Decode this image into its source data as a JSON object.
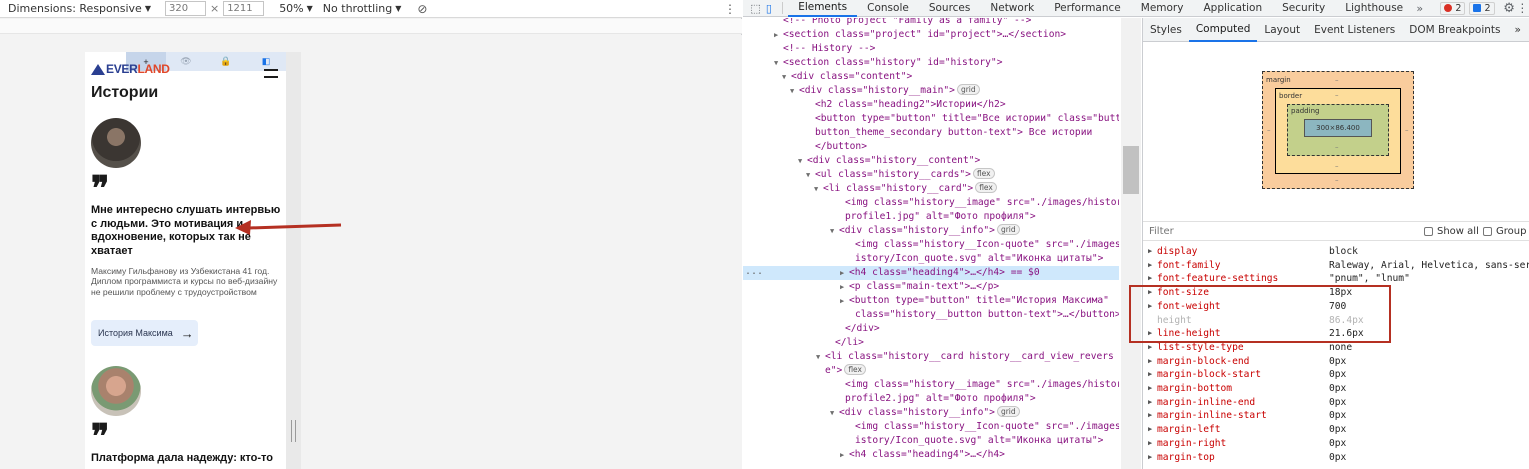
{
  "device_toolbar": {
    "dimensions_label": "Dimensions: Responsive",
    "width_value": "320",
    "times": "×",
    "height_value": "1211",
    "zoom": "50%",
    "throttling": "No throttling"
  },
  "viewport": {
    "toolbar_glyphs": [
      "+",
      "👁",
      "🔒",
      "◧"
    ],
    "logo_text_a": "EVER",
    "logo_text_b": "LAND",
    "heading": "Истории",
    "card1": {
      "quote_mark": "❞",
      "title": "Мне интересно слушать интервью с людьми. Это мотивация и вдохновение, которых так не хватает",
      "text": "Максиму Гильфанову из Узбекистана 41 год. Диплом программиста и курсы по веб-дизайну не решили проблему с трудоустройством",
      "button_label": "История Максима",
      "button_arrow": "→"
    },
    "card2": {
      "quote_mark": "❞",
      "title": "Платформа дала надежду: кто-то"
    }
  },
  "devtools_tabs": {
    "items": [
      "Elements",
      "Console",
      "Sources",
      "Network",
      "Performance",
      "Memory",
      "Application",
      "Security",
      "Lighthouse"
    ],
    "more": "»",
    "errors_count": "2",
    "messages_count": "2",
    "settings_glyph": "⚙",
    "menu_glyph": "⋮"
  },
  "elements": {
    "lines": [
      {
        "t": "<!-- Photo project \"Family as a family\" -->"
      },
      {
        "t": "<section class=\"project\" id=\"project\">…</section>"
      },
      {
        "t": "<!-- History -->"
      },
      {
        "t": "<section class=\"history\" id=\"history\">"
      },
      {
        "t": "<div class=\"content\">"
      },
      {
        "t": "<div class=\"history__main\">",
        "pill": "grid"
      },
      {
        "t": "<h2 class=\"heading2\">Истории</h2>"
      },
      {
        "t": "<button type=\"button\" title=\"Все истории\" class=\"button"
      },
      {
        "t": "button_theme_secondary button-text\"> Все истории"
      },
      {
        "t": "</button>"
      },
      {
        "t": "<div class=\"history__content\">"
      },
      {
        "t": "<ul class=\"history__cards\">",
        "pill": "flex"
      },
      {
        "t": "<li class=\"history__card\">",
        "pill": "flex"
      },
      {
        "t": "<img class=\"history__image\" src=\"./images/history/"
      },
      {
        "t": "profile1.jpg\" alt=\"Фото профиля\">"
      },
      {
        "t": "<div class=\"history__info\">",
        "pill": "grid"
      },
      {
        "t": "<img class=\"history__Icon-quote\" src=\"./images/h"
      },
      {
        "t": "istory/Icon_quote.svg\" alt=\"Иконка цитаты\">"
      },
      {
        "t": "<h4 class=\"heading4\">…</h4> == $0",
        "selected": true
      },
      {
        "t": "<p class=\"main-text\">…</p>"
      },
      {
        "t": "<button type=\"button\" title=\"История Максима\""
      },
      {
        "t": "class=\"history__button button-text\">…</button>"
      },
      {
        "t": "</div>"
      },
      {
        "t": "</li>"
      },
      {
        "t": "<li class=\"history__card history__card_view_revers"
      },
      {
        "t": "e\">",
        "pill": "flex"
      },
      {
        "t": "<img class=\"history__image\" src=\"./images/history/"
      },
      {
        "t": "profile2.jpg\" alt=\"Фото профиля\">"
      },
      {
        "t": "<div class=\"history__info\">",
        "pill": "grid"
      },
      {
        "t": "<img class=\"history__Icon-quote\" src=\"./images/h"
      },
      {
        "t": "istory/Icon_quote.svg\" alt=\"Иконка цитаты\">"
      },
      {
        "t": "<h4 class=\"heading4\">…</h4>"
      }
    ],
    "ellipsis": "..."
  },
  "side_panel": {
    "tabs": [
      "Styles",
      "Computed",
      "Layout",
      "Event Listeners",
      "DOM Breakpoints"
    ],
    "more": "»",
    "box_model": {
      "margin_label": "margin",
      "border_label": "border",
      "padding_label": "padding",
      "content_size": "300×86.400",
      "dash": "–"
    },
    "filter_placeholder": "Filter",
    "show_all_label": "Show all",
    "group_label": "Group",
    "properties": [
      {
        "name": "display",
        "value": "block"
      },
      {
        "name": "font-family",
        "value": "Raleway, Arial, Helvetica, sans-seri"
      },
      {
        "name": "font-feature-settings",
        "value": "\"pnum\", \"lnum\""
      },
      {
        "name": "font-size",
        "value": "18px"
      },
      {
        "name": "font-weight",
        "value": "700"
      },
      {
        "name": "height",
        "value": "86.4px",
        "inherited": true
      },
      {
        "name": "line-height",
        "value": "21.6px"
      },
      {
        "name": "list-style-type",
        "value": "none"
      },
      {
        "name": "margin-block-end",
        "value": "0px"
      },
      {
        "name": "margin-block-start",
        "value": "0px"
      },
      {
        "name": "margin-bottom",
        "value": "0px"
      },
      {
        "name": "margin-inline-end",
        "value": "0px"
      },
      {
        "name": "margin-inline-start",
        "value": "0px"
      },
      {
        "name": "margin-left",
        "value": "0px"
      },
      {
        "name": "margin-right",
        "value": "0px"
      },
      {
        "name": "margin-top",
        "value": "0px"
      }
    ]
  },
  "colors": {
    "accent": "#1a73e8",
    "highlight_box": "#b53022",
    "annotation_arrow": "#b53022"
  }
}
